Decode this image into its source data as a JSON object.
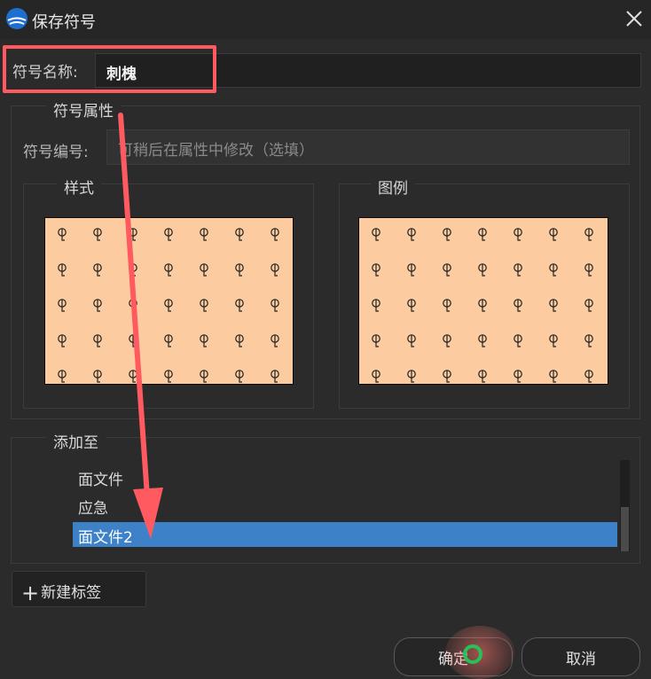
{
  "window": {
    "title": "保存符号",
    "logo_icon": "app-logo-icon",
    "close_icon": "close-icon"
  },
  "symbol_name": {
    "label": "符号名称:",
    "value": "刺槐"
  },
  "attributes": {
    "title": "符号属性",
    "code_label": "符号编号:",
    "code_placeholder": "可稍后在属性中修改（选填）",
    "style_title": "样式",
    "legend_title": "图例",
    "pattern_glyph": "tree-symbol-icon",
    "preview_fill": "#fccb9f"
  },
  "add_to": {
    "title": "添加至",
    "items": [
      {
        "label": "面文件",
        "selected": false
      },
      {
        "label": "应急",
        "selected": false
      },
      {
        "label": "面文件2",
        "selected": true
      }
    ],
    "selection_color": "#3d82c8"
  },
  "buttons": {
    "new_tag": "新建标签",
    "ok": "确定",
    "cancel": "取消"
  },
  "annotation": {
    "highlight_color": "#ff5a5f"
  }
}
